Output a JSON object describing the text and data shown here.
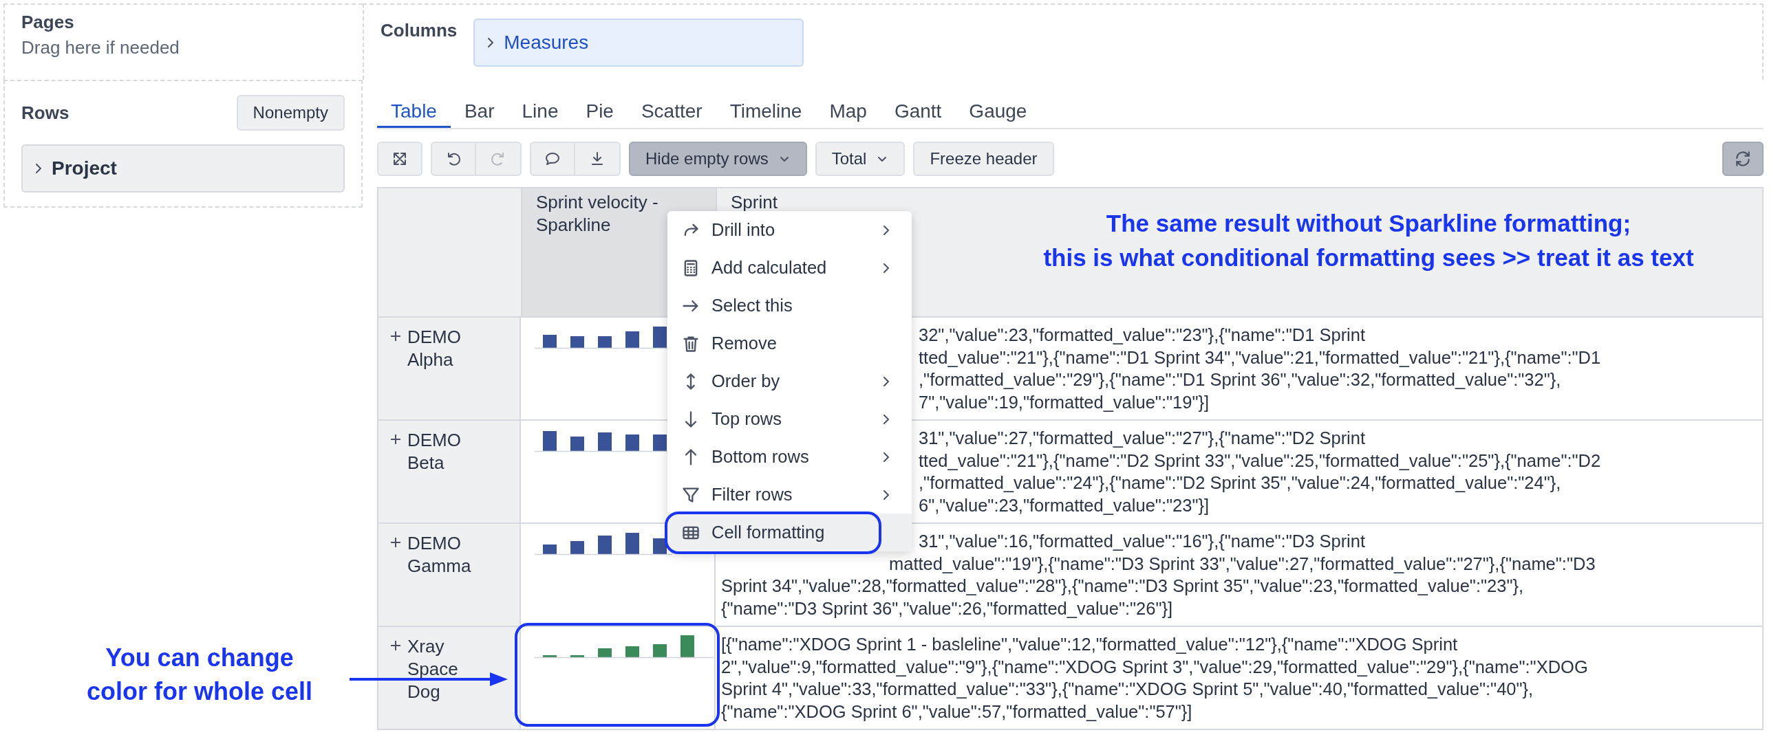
{
  "pages_panel": {
    "title": "Pages",
    "hint": "Drag here if needed"
  },
  "columns_panel": {
    "title": "Columns",
    "chips": [
      {
        "label": "Measures",
        "expanded": false
      }
    ]
  },
  "rows_panel": {
    "title": "Rows",
    "button": "Nonempty",
    "chips": [
      {
        "label": "Project",
        "expanded": false
      }
    ]
  },
  "tabs": [
    {
      "label": "Table",
      "selected": true
    },
    {
      "label": "Bar",
      "selected": false
    },
    {
      "label": "Line",
      "selected": false
    },
    {
      "label": "Pie",
      "selected": false
    },
    {
      "label": "Scatter",
      "selected": false
    },
    {
      "label": "Timeline",
      "selected": false
    },
    {
      "label": "Map",
      "selected": false
    },
    {
      "label": "Gantt",
      "selected": false
    },
    {
      "label": "Gauge",
      "selected": false
    }
  ],
  "toolbar": {
    "groups": [
      {
        "kind": "icons",
        "buttons": [
          {
            "disabled": false
          }
        ]
      },
      {
        "kind": "icons",
        "buttons": [
          {
            "disabled": false
          },
          {
            "disabled": true
          }
        ]
      },
      {
        "kind": "icons",
        "buttons": [
          {
            "disabled": false
          },
          {
            "disabled": false
          }
        ]
      },
      {
        "kind": "dropdown",
        "label": "Hide empty rows",
        "on": true
      },
      {
        "kind": "dropdown",
        "label": "Total",
        "on": false
      },
      {
        "kind": "button",
        "label": "Freeze header",
        "on": false
      }
    ],
    "refresh": {
      "on": true
    }
  },
  "table": {
    "columns": [
      {
        "label": "Sprint velocity - Sparkline",
        "selected": true
      },
      {
        "label": "Sprint",
        "selected": false
      }
    ],
    "rows": [
      {
        "label": "DEMO Alpha",
        "expanded": false,
        "color": "#3a5297",
        "lines": [
          "32\",\"value\":23,\"formatted_value\":\"23\"},{\"name\":\"D1 Sprint",
          "tted_value\":\"21\"},{\"name\":\"D1 Sprint 34\",\"value\":21,\"formatted_value\":\"21\"},{\"name\":\"D1",
          ",\"formatted_value\":\"29\"},{\"name\":\"D1 Sprint 36\",\"value\":32,\"formatted_value\":\"32\"},",
          "7\",\"value\":19,\"formatted_value\":\"19\"}]"
        ]
      },
      {
        "label": "DEMO Beta",
        "expanded": false,
        "color": "#3a5297",
        "lines": [
          "31\",\"value\":27,\"formatted_value\":\"27\"},{\"name\":\"D2 Sprint",
          "tted_value\":\"21\"},{\"name\":\"D2 Sprint 33\",\"value\":25,\"formatted_value\":\"25\"},{\"name\":\"D2",
          ",\"formatted_value\":\"24\"},{\"name\":\"D2 Sprint 35\",\"value\":24,\"formatted_value\":\"24\"},",
          "6\",\"value\":23,\"formatted_value\":\"23\"}]"
        ]
      },
      {
        "label": "DEMO Gamma",
        "expanded": false,
        "color": "#3a5297",
        "lines": [
          "31\",\"value\":16,\"formatted_value\":\"16\"},{\"name\":\"D3 Sprint",
          "matted_value\":\"19\"},{\"name\":\"D3 Sprint 33\",\"value\":27,\"formatted_value\":\"27\"},{\"name\":\"D3",
          "Sprint 34\",\"value\":28,\"formatted_value\":\"28\"},{\"name\":\"D3 Sprint 35\",\"value\":23,\"formatted_value\":\"23\"},",
          "{\"name\":\"D3 Sprint 36\",\"value\":26,\"formatted_value\":\"26\"}]"
        ]
      },
      {
        "label": "Xray Space Dog",
        "expanded": false,
        "color": "#3a8a5a",
        "lines": [
          "[{\"name\":\"XDOG Sprint 1 - basleline\",\"value\":12,\"formatted_value\":\"12\"},{\"name\":\"XDOG Sprint",
          "2\",\"value\":9,\"formatted_value\":\"9\"},{\"name\":\"XDOG Sprint 3\",\"value\":29,\"formatted_value\":\"29\"},{\"name\":\"XDOG",
          "Sprint 4\",\"value\":33,\"formatted_value\":\"33\"},{\"name\":\"XDOG Sprint 5\",\"value\":40,\"formatted_value\":\"40\"},",
          "{\"name\":\"XDOG Sprint 6\",\"value\":57,\"formatted_value\":\"57\"}]"
        ]
      }
    ]
  },
  "context_menu": {
    "items": [
      {
        "label": "Drill into",
        "submenu": true,
        "selected": false
      },
      {
        "label": "Add calculated",
        "submenu": true,
        "selected": false
      },
      {
        "label": "Select this",
        "submenu": false,
        "selected": false
      },
      {
        "label": "Remove",
        "submenu": false,
        "selected": false
      },
      {
        "label": "Order by",
        "submenu": true,
        "selected": false
      },
      {
        "label": "Top rows",
        "submenu": true,
        "selected": false
      },
      {
        "label": "Bottom rows",
        "submenu": true,
        "selected": false
      },
      {
        "label": "Filter rows",
        "submenu": true,
        "selected": false
      },
      {
        "label": "Cell formatting",
        "submenu": false,
        "selected": true
      }
    ]
  },
  "annotations": [
    {
      "kind": "note",
      "text": "The same result without Sparkline formatting;\nthis is what conditional formatting sees >> treat it as text"
    },
    {
      "kind": "callout",
      "text": "You can change\ncolor for whole cell"
    }
  ]
}
